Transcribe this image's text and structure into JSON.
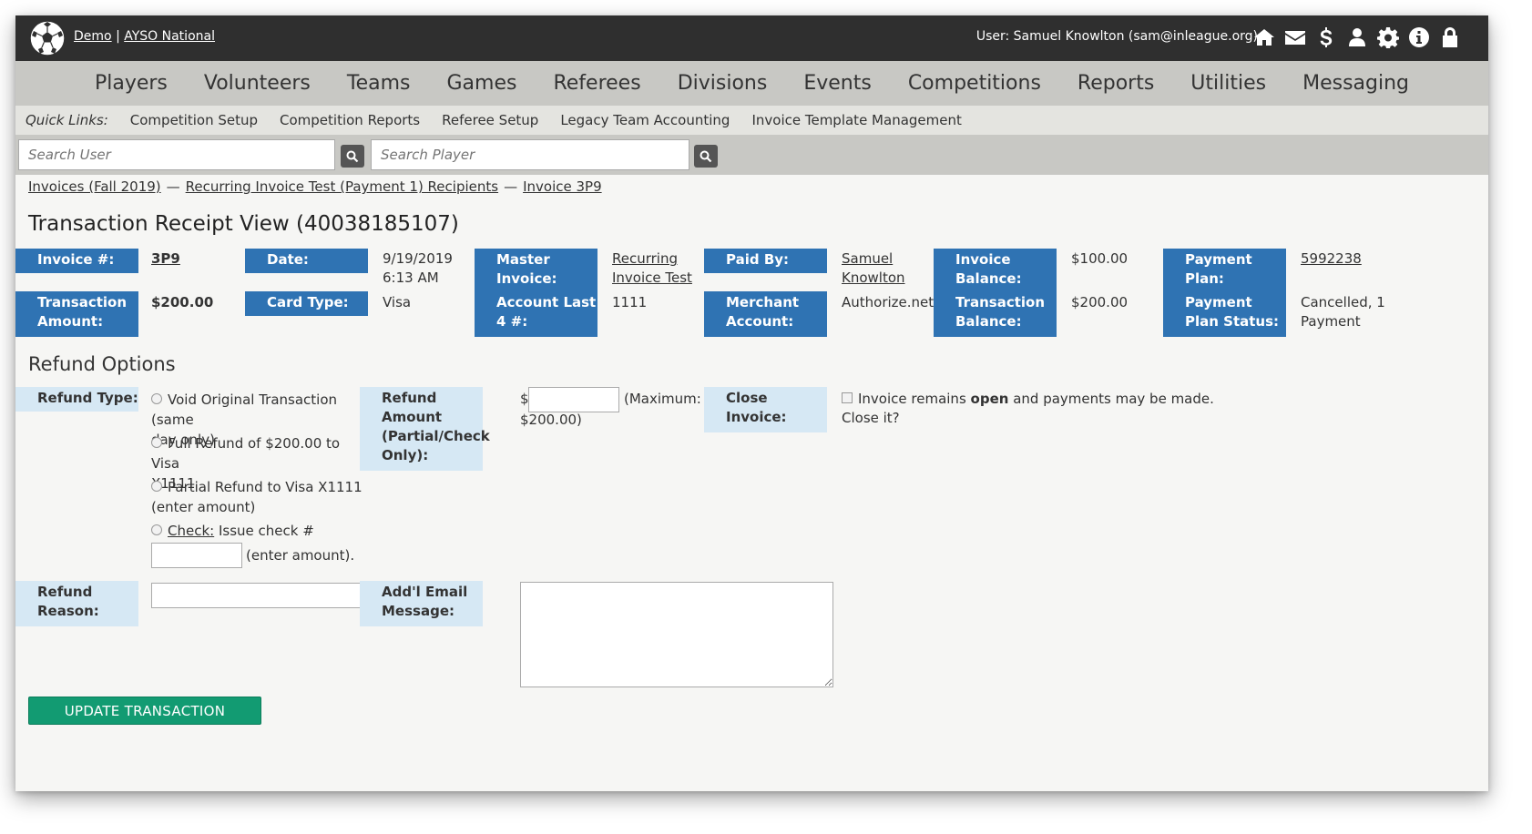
{
  "header": {
    "demo_link": "Demo",
    "separator": "|",
    "org_link": "AYSO National",
    "user_text": "User: Samuel Knowlton (sam@inleague.org)",
    "icons": [
      "home-icon",
      "mail-icon",
      "dollar-icon",
      "user-icon",
      "gear-icon",
      "info-icon",
      "lock-icon"
    ]
  },
  "nav": {
    "items": [
      "Players",
      "Volunteers",
      "Teams",
      "Games",
      "Referees",
      "Divisions",
      "Events",
      "Competitions",
      "Reports",
      "Utilities",
      "Messaging"
    ]
  },
  "quicklinks": {
    "label": "Quick Links:",
    "items": [
      "Competition Setup",
      "Competition Reports",
      "Referee Setup",
      "Legacy Team Accounting",
      "Invoice Template Management"
    ]
  },
  "search": {
    "user_placeholder": "Search User",
    "player_placeholder": "Search Player"
  },
  "breadcrumb": {
    "items": [
      "Invoices (Fall 2019)",
      "Recurring Invoice Test (Payment 1) Recipients",
      "Invoice 3P9"
    ],
    "separator": "—"
  },
  "page_title": "Transaction Receipt View (40038185107)",
  "details": {
    "invoice_num_label": "Invoice #:",
    "invoice_num_value": "3P9",
    "date_label": "Date:",
    "date_value_1": "9/19/2019",
    "date_value_2": "6:13 AM",
    "master_invoice_label_1": "Master",
    "master_invoice_label_2": "Invoice:",
    "master_invoice_value_1": "Recurring",
    "master_invoice_value_2": "Invoice Test",
    "paid_by_label": "Paid By:",
    "paid_by_value_1": "Samuel",
    "paid_by_value_2": "Knowlton",
    "invoice_balance_label_1": "Invoice",
    "invoice_balance_label_2": "Balance:",
    "invoice_balance_value": "$100.00",
    "payment_plan_label_1": "Payment",
    "payment_plan_label_2": "Plan:",
    "payment_plan_value": "5992238",
    "transaction_amount_label_1": "Transaction",
    "transaction_amount_label_2": "Amount:",
    "transaction_amount_value": "$200.00",
    "card_type_label": "Card Type:",
    "card_type_value": "Visa",
    "account_last_label_1": "Account Last",
    "account_last_label_2": "4 #:",
    "account_last_value": "1111",
    "merchant_label_1": "Merchant",
    "merchant_label_2": "Account:",
    "merchant_value": "Authorize.net",
    "transaction_balance_label_1": "Transaction",
    "transaction_balance_label_2": "Balance:",
    "transaction_balance_value": "$200.00",
    "plan_status_label_1": "Payment",
    "plan_status_label_2": "Plan Status:",
    "plan_status_value_1": "Cancelled, 1",
    "plan_status_value_2": "Payment"
  },
  "refund": {
    "section_title": "Refund Options",
    "type_label": "Refund Type:",
    "opt_void_1": "Void Original Transaction (same",
    "opt_void_2": "day only)",
    "opt_full_1": "Full Refund of $200.00 to Visa",
    "opt_full_2": "X1111",
    "opt_partial_1": "Partial Refund to Visa X1111",
    "opt_partial_2": "(enter amount)",
    "opt_check_link": "Check:",
    "opt_check_text": " Issue check #",
    "opt_check_suffix": "(enter amount).",
    "amount_label_1": "Refund",
    "amount_label_2": "Amount",
    "amount_label_3": "(Partial/Check",
    "amount_label_4": "Only):",
    "amount_prefix": "$",
    "amount_max_1": "(Maximum:",
    "amount_max_2": "$200.00)",
    "close_label_1": "Close",
    "close_label_2": "Invoice:",
    "close_text_pre": "Invoice remains ",
    "close_text_bold": "open",
    "close_text_post": " and payments may be made.",
    "close_text_2": "Close it?",
    "reason_label_1": "Refund",
    "reason_label_2": "Reason:",
    "email_label_1": "Add'l Email",
    "email_label_2": "Message:",
    "update_button": "UPDATE TRANSACTION"
  }
}
